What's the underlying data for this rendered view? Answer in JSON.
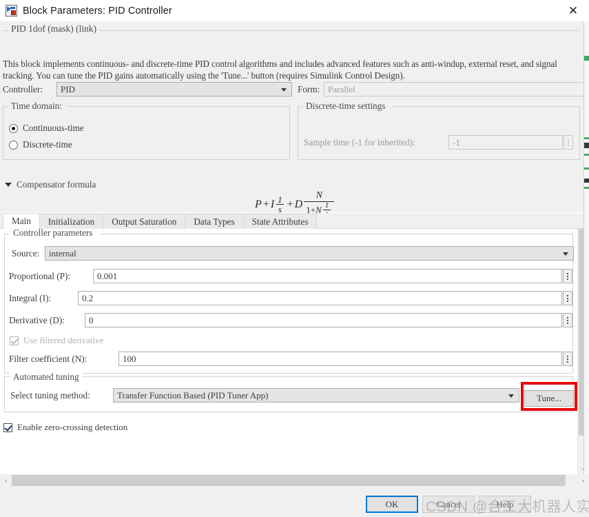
{
  "window": {
    "title": "Block Parameters: PID Controller",
    "icon": "simulink-block-icon",
    "close_label": "✕"
  },
  "mask": {
    "group_label": "PID 1dof (mask) (link)",
    "description": "This block implements continuous- and discrete-time PID control algorithms and includes advanced features such as anti-windup, external reset, and signal tracking. You can tune the PID gains automatically using the 'Tune...' button (requires Simulink Control Design)."
  },
  "controller_row": {
    "controller_label": "Controller:",
    "controller_value": "PID",
    "form_label": "Form:",
    "form_value": "Parallel"
  },
  "time_domain": {
    "legend": "Time domain:",
    "options": [
      {
        "label": "Continuous-time",
        "selected": true
      },
      {
        "label": "Discrete-time",
        "selected": false
      }
    ]
  },
  "discrete_settings": {
    "legend": "Discrete-time settings",
    "sample_time_label": "Sample time (-1 for inherited):",
    "sample_time_value": "-1",
    "enabled": false
  },
  "compensator": {
    "toggle_label": "Compensator formula",
    "expanded": true,
    "formula": {
      "p_term": "P",
      "plus1": "+",
      "i_term": "I",
      "i_frac_num": "1",
      "i_frac_den": "s",
      "plus2": "+",
      "d_term": "D",
      "d_frac_num": "N",
      "d_frac_den_one": "1+",
      "d_frac_den_n": "N",
      "d_frac_den_num": "1",
      "d_frac_den_den": "s"
    }
  },
  "tabs": [
    {
      "label": "Main",
      "active": true
    },
    {
      "label": "Initialization",
      "active": false
    },
    {
      "label": "Output Saturation",
      "active": false
    },
    {
      "label": "Data Types",
      "active": false
    },
    {
      "label": "State Attributes",
      "active": false
    }
  ],
  "controller_parameters": {
    "legend": "Controller parameters",
    "source_label": "Source:",
    "source_value": "internal",
    "fields": [
      {
        "label": "Proportional (P):",
        "value": "0.001"
      },
      {
        "label": "Integral (I):",
        "value": "0.2"
      },
      {
        "label": "Derivative (D):",
        "value": "0"
      }
    ],
    "use_filtered_derivative": {
      "label": "Use filtered derivative",
      "checked": true,
      "enabled": false
    },
    "filter_coefficient": {
      "label": "Filter coefficient (N):",
      "value": "100"
    }
  },
  "automated_tuning": {
    "legend": "Automated tuning",
    "method_label": "Select tuning method:",
    "method_value": "Transfer Function Based (PID Tuner App)",
    "tune_button": "Tune...",
    "highlight_color": "#e8070f"
  },
  "zero_crossing": {
    "label": "Enable zero-crossing detection",
    "checked": true
  },
  "scrollbars": {
    "vertical_down_arrow": "⌄",
    "horizontal_left_arrow": "‹",
    "horizontal_right_arrow": "›"
  },
  "footer": {
    "ok": "OK",
    "cancel": "Cancel",
    "help": "Help",
    "accent_color": "#0078d7"
  },
  "watermark": {
    "text": "CSDN @合工大机器人实验室"
  }
}
